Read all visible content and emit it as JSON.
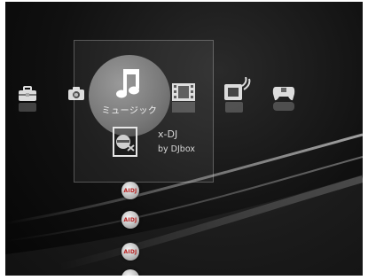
{
  "categories": [
    {
      "name": "settings-category",
      "icon": "toolbox-icon"
    },
    {
      "name": "photo-category",
      "icon": "camera-icon"
    },
    {
      "name": "music-category",
      "icon": "music-note-icon",
      "label": "ミュージック",
      "selected": true
    },
    {
      "name": "video-category",
      "icon": "film-icon"
    },
    {
      "name": "tv-category",
      "icon": "tv-icon"
    },
    {
      "name": "game-category",
      "icon": "gamepad-icon"
    }
  ],
  "selected_item": {
    "title": "x-DJ",
    "subtitle": "by DJbox",
    "icon": "x-dj-icon"
  },
  "list_items": [
    {
      "label": "AIDJ"
    },
    {
      "label": "AIDJ"
    },
    {
      "label": "AIDJ"
    }
  ]
}
